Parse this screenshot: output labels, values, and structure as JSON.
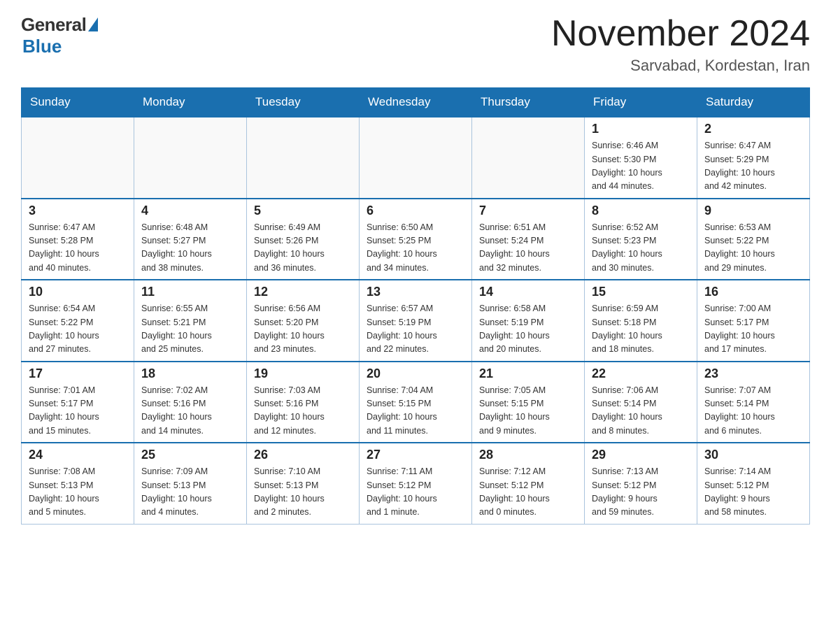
{
  "header": {
    "logo": {
      "general": "General",
      "blue": "Blue"
    },
    "title": "November 2024",
    "location": "Sarvabad, Kordestan, Iran"
  },
  "weekdays": [
    "Sunday",
    "Monday",
    "Tuesday",
    "Wednesday",
    "Thursday",
    "Friday",
    "Saturday"
  ],
  "weeks": [
    [
      {
        "day": "",
        "info": ""
      },
      {
        "day": "",
        "info": ""
      },
      {
        "day": "",
        "info": ""
      },
      {
        "day": "",
        "info": ""
      },
      {
        "day": "",
        "info": ""
      },
      {
        "day": "1",
        "info": "Sunrise: 6:46 AM\nSunset: 5:30 PM\nDaylight: 10 hours\nand 44 minutes."
      },
      {
        "day": "2",
        "info": "Sunrise: 6:47 AM\nSunset: 5:29 PM\nDaylight: 10 hours\nand 42 minutes."
      }
    ],
    [
      {
        "day": "3",
        "info": "Sunrise: 6:47 AM\nSunset: 5:28 PM\nDaylight: 10 hours\nand 40 minutes."
      },
      {
        "day": "4",
        "info": "Sunrise: 6:48 AM\nSunset: 5:27 PM\nDaylight: 10 hours\nand 38 minutes."
      },
      {
        "day": "5",
        "info": "Sunrise: 6:49 AM\nSunset: 5:26 PM\nDaylight: 10 hours\nand 36 minutes."
      },
      {
        "day": "6",
        "info": "Sunrise: 6:50 AM\nSunset: 5:25 PM\nDaylight: 10 hours\nand 34 minutes."
      },
      {
        "day": "7",
        "info": "Sunrise: 6:51 AM\nSunset: 5:24 PM\nDaylight: 10 hours\nand 32 minutes."
      },
      {
        "day": "8",
        "info": "Sunrise: 6:52 AM\nSunset: 5:23 PM\nDaylight: 10 hours\nand 30 minutes."
      },
      {
        "day": "9",
        "info": "Sunrise: 6:53 AM\nSunset: 5:22 PM\nDaylight: 10 hours\nand 29 minutes."
      }
    ],
    [
      {
        "day": "10",
        "info": "Sunrise: 6:54 AM\nSunset: 5:22 PM\nDaylight: 10 hours\nand 27 minutes."
      },
      {
        "day": "11",
        "info": "Sunrise: 6:55 AM\nSunset: 5:21 PM\nDaylight: 10 hours\nand 25 minutes."
      },
      {
        "day": "12",
        "info": "Sunrise: 6:56 AM\nSunset: 5:20 PM\nDaylight: 10 hours\nand 23 minutes."
      },
      {
        "day": "13",
        "info": "Sunrise: 6:57 AM\nSunset: 5:19 PM\nDaylight: 10 hours\nand 22 minutes."
      },
      {
        "day": "14",
        "info": "Sunrise: 6:58 AM\nSunset: 5:19 PM\nDaylight: 10 hours\nand 20 minutes."
      },
      {
        "day": "15",
        "info": "Sunrise: 6:59 AM\nSunset: 5:18 PM\nDaylight: 10 hours\nand 18 minutes."
      },
      {
        "day": "16",
        "info": "Sunrise: 7:00 AM\nSunset: 5:17 PM\nDaylight: 10 hours\nand 17 minutes."
      }
    ],
    [
      {
        "day": "17",
        "info": "Sunrise: 7:01 AM\nSunset: 5:17 PM\nDaylight: 10 hours\nand 15 minutes."
      },
      {
        "day": "18",
        "info": "Sunrise: 7:02 AM\nSunset: 5:16 PM\nDaylight: 10 hours\nand 14 minutes."
      },
      {
        "day": "19",
        "info": "Sunrise: 7:03 AM\nSunset: 5:16 PM\nDaylight: 10 hours\nand 12 minutes."
      },
      {
        "day": "20",
        "info": "Sunrise: 7:04 AM\nSunset: 5:15 PM\nDaylight: 10 hours\nand 11 minutes."
      },
      {
        "day": "21",
        "info": "Sunrise: 7:05 AM\nSunset: 5:15 PM\nDaylight: 10 hours\nand 9 minutes."
      },
      {
        "day": "22",
        "info": "Sunrise: 7:06 AM\nSunset: 5:14 PM\nDaylight: 10 hours\nand 8 minutes."
      },
      {
        "day": "23",
        "info": "Sunrise: 7:07 AM\nSunset: 5:14 PM\nDaylight: 10 hours\nand 6 minutes."
      }
    ],
    [
      {
        "day": "24",
        "info": "Sunrise: 7:08 AM\nSunset: 5:13 PM\nDaylight: 10 hours\nand 5 minutes."
      },
      {
        "day": "25",
        "info": "Sunrise: 7:09 AM\nSunset: 5:13 PM\nDaylight: 10 hours\nand 4 minutes."
      },
      {
        "day": "26",
        "info": "Sunrise: 7:10 AM\nSunset: 5:13 PM\nDaylight: 10 hours\nand 2 minutes."
      },
      {
        "day": "27",
        "info": "Sunrise: 7:11 AM\nSunset: 5:12 PM\nDaylight: 10 hours\nand 1 minute."
      },
      {
        "day": "28",
        "info": "Sunrise: 7:12 AM\nSunset: 5:12 PM\nDaylight: 10 hours\nand 0 minutes."
      },
      {
        "day": "29",
        "info": "Sunrise: 7:13 AM\nSunset: 5:12 PM\nDaylight: 9 hours\nand 59 minutes."
      },
      {
        "day": "30",
        "info": "Sunrise: 7:14 AM\nSunset: 5:12 PM\nDaylight: 9 hours\nand 58 minutes."
      }
    ]
  ]
}
